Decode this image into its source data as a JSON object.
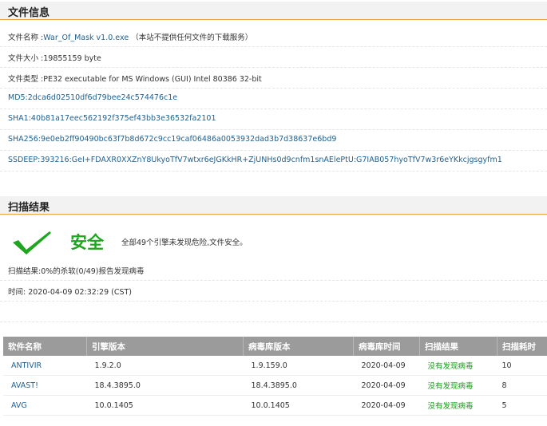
{
  "file_info": {
    "title": "文件信息",
    "rows": [
      {
        "label": "文件名称 :",
        "value": "War_Of_Mask v1.0.exe",
        "note": "（本站不提供任何文件的下载服务）"
      },
      {
        "label": "文件大小 :",
        "value": "19855159 byte",
        "note": ""
      },
      {
        "label": "文件类型 :",
        "value": "PE32 executable for MS Windows (GUI) Intel 80386 32-bit",
        "note": ""
      },
      {
        "label": "MD5:",
        "value": "2dca6d02510df6d79bee24c574476c1e",
        "note": ""
      },
      {
        "label": "SHA1:",
        "value": "40b81a17eec562192f375ef43bb3e36532fa2101",
        "note": ""
      },
      {
        "label": "SHA256:",
        "value": "9e0eb2ff90490bc63f7b8d672c9cc19caf06486a0053932dad3b7d38637e6bd9",
        "note": ""
      },
      {
        "label": "SSDEEP:",
        "value": "393216:GeI+FDAXR0XXZnY8UkyoTfV7wtxr6eJGKkHR+ZjUNHs0d9cnfm1snAElePtU:G7IAB057hyoTfV7w3r6eYKkcjgsgyfm1",
        "note": ""
      }
    ]
  },
  "scan": {
    "title": "扫描结果",
    "status": "安全",
    "status_desc": "全部49个引擎未发现危险,文件安全。",
    "summary": "扫描结果:0%的杀软(0/49)报告发现病毒",
    "time": "时间: 2020-04-09 02:32:29 (CST)"
  },
  "table": {
    "headers": [
      "软件名称",
      "引擎版本",
      "病毒库版本",
      "病毒库时间",
      "扫描结果",
      "扫描耗时"
    ],
    "rows": [
      [
        "ANTIVIR",
        "1.9.2.0",
        "1.9.159.0",
        "2020-04-09",
        "没有发现病毒",
        "10"
      ],
      [
        "AVAST!",
        "18.4.3895.0",
        "18.4.3895.0",
        "2020-04-09",
        "没有发现病毒",
        "8"
      ],
      [
        "AVG",
        "10.0.1405",
        "10.0.1405",
        "2020-04-09",
        "没有发现病毒",
        "5"
      ]
    ]
  },
  "colors": {
    "accent": "#e8a33d",
    "safe": "#1fa51f",
    "link": "#1f5f8f",
    "table_header": "#9b9b9b"
  }
}
